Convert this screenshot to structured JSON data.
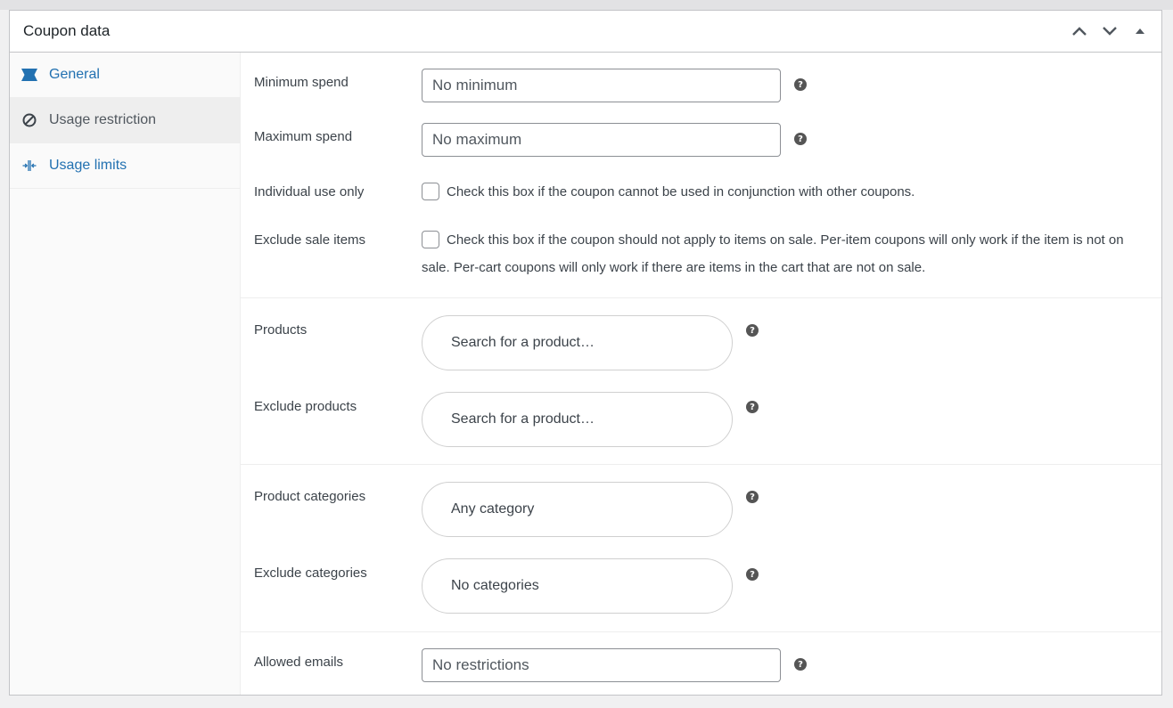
{
  "panel": {
    "title": "Coupon data",
    "controls": [
      "chevron-up-icon",
      "chevron-down-icon",
      "triangle-up-icon"
    ]
  },
  "tabs": [
    {
      "label": "General",
      "icon": "ticket-icon",
      "active": false
    },
    {
      "label": "Usage restriction",
      "icon": "block-icon",
      "active": true
    },
    {
      "label": "Usage limits",
      "icon": "limits-icon",
      "active": false
    }
  ],
  "fields": {
    "minimum_spend": {
      "label": "Minimum spend",
      "placeholder": "No minimum",
      "value": ""
    },
    "maximum_spend": {
      "label": "Maximum spend",
      "placeholder": "No maximum",
      "value": ""
    },
    "individual_use": {
      "label": "Individual use only",
      "checked": false,
      "description": "Check this box if the coupon cannot be used in conjunction with other coupons."
    },
    "exclude_sale": {
      "label": "Exclude sale items",
      "checked": false,
      "description": "Check this box if the coupon should not apply to items on sale. Per-item coupons will only work if the item is not on sale. Per-cart coupons will only work if there are items in the cart that are not on sale."
    },
    "products": {
      "label": "Products",
      "placeholder": "Search for a product…"
    },
    "exclude_products": {
      "label": "Exclude products",
      "placeholder": "Search for a product…"
    },
    "product_categories": {
      "label": "Product categories",
      "placeholder": "Any category"
    },
    "exclude_categories": {
      "label": "Exclude categories",
      "placeholder": "No categories"
    },
    "allowed_emails": {
      "label": "Allowed emails",
      "placeholder": "No restrictions",
      "value": ""
    }
  },
  "help_glyph": "?",
  "colors": {
    "link": "#2271b1",
    "border": "#c3c4c7",
    "sidebar_bg": "#fafafa",
    "active_tab_bg": "#eeeeee"
  }
}
